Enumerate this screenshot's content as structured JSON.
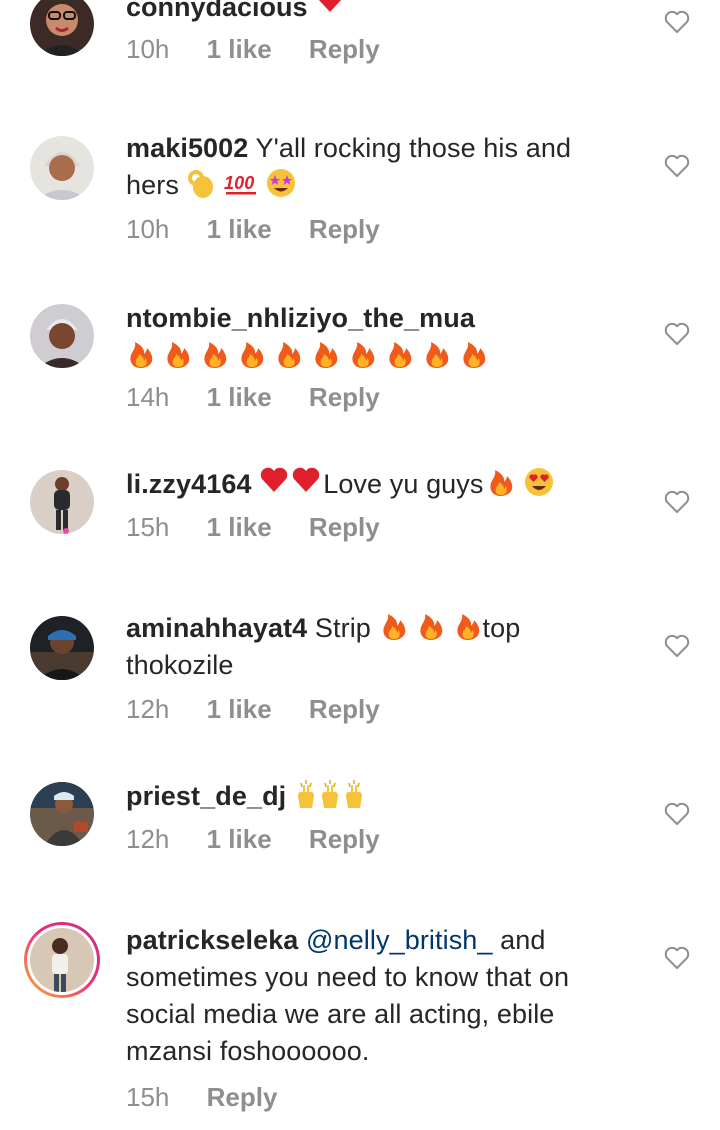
{
  "comments": [
    {
      "username": "connydacious",
      "text": "",
      "time": "10h",
      "likes": "1 like",
      "reply": "Reply",
      "emoji": [
        "red-heart"
      ]
    },
    {
      "username": "maki5002",
      "text_line1": "Y'all rocking those his and",
      "text_line2": "hers",
      "time": "10h",
      "likes": "1 like",
      "reply": "Reply",
      "emoji": [
        "ok-hand",
        "hundred-points",
        "star-struck"
      ]
    },
    {
      "username": "ntombie_nhliziyo_the_mua",
      "text": "",
      "time": "14h",
      "likes": "1 like",
      "reply": "Reply",
      "emoji": [
        "fire",
        "fire",
        "fire",
        "fire",
        "fire",
        "fire",
        "fire",
        "fire",
        "fire",
        "fire"
      ]
    },
    {
      "username": "li.zzy4164",
      "text": "Love yu guys",
      "time": "15h",
      "likes": "1 like",
      "reply": "Reply",
      "emoji": [
        "red-heart",
        "red-heart",
        "fire",
        "heart-eyes"
      ]
    },
    {
      "username": "aminahhayat4",
      "text_before": "Strip",
      "text_after": "top",
      "text_line2": "thokozile",
      "time": "12h",
      "likes": "1 like",
      "reply": "Reply",
      "emoji": [
        "fire",
        "fire",
        "fire"
      ]
    },
    {
      "username": "priest_de_dj",
      "text": "",
      "time": "12h",
      "likes": "1 like",
      "reply": "Reply",
      "emoji": [
        "raising-hands",
        "raising-hands",
        "raising-hands"
      ]
    },
    {
      "username": "patrickseleka",
      "mention": "@nelly_british_",
      "text_line1": "and",
      "text_line2": "sometimes you need to know that on",
      "text_line3": "social media we are all acting, ebile",
      "text_line4": "mzansi foshoooooo.",
      "time": "15h",
      "reply": "Reply"
    }
  ],
  "colors": {
    "text": "#262626",
    "meta": "#8e8e8e",
    "mention": "#00376b",
    "heart_outline": "#8e8e8e"
  }
}
